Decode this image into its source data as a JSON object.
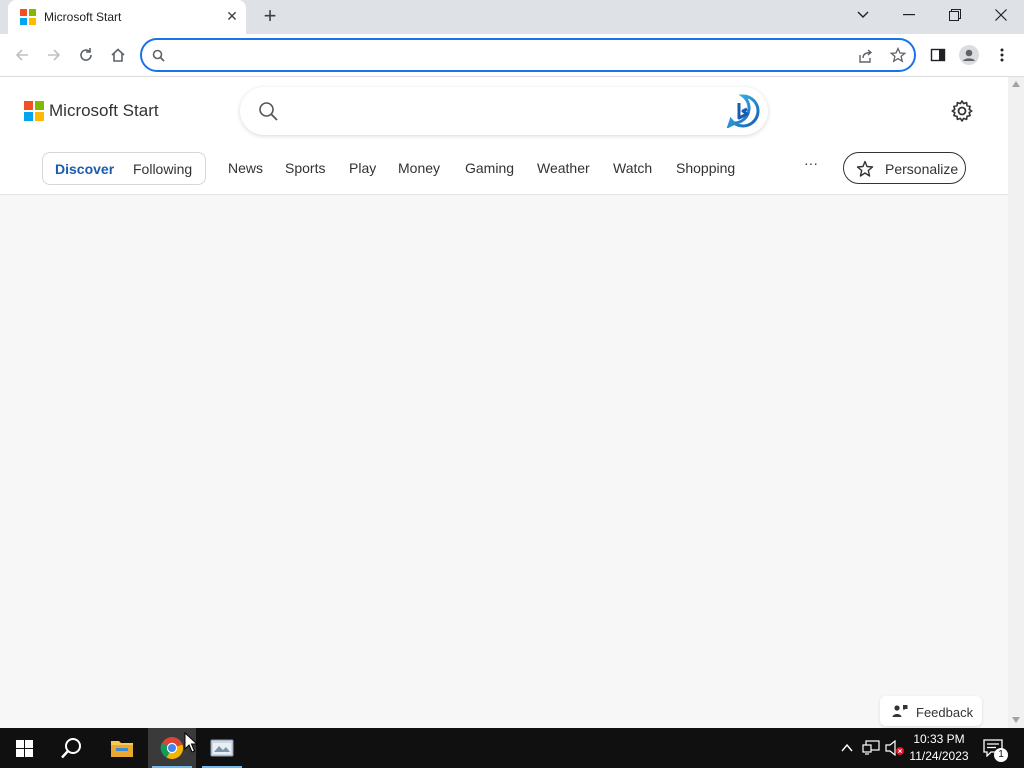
{
  "browser": {
    "tab_title": "Microsoft Start",
    "tab_close": "✕",
    "new_tab": "+",
    "address_value": "",
    "address_placeholder": ""
  },
  "window_controls": {
    "dropdown": "⌄",
    "minimize": "—",
    "restore": "❐",
    "close": "✕"
  },
  "site": {
    "logo_text": "Microsoft Start",
    "search_placeholder": "",
    "pill_tabs": [
      {
        "label": "Discover",
        "active": true
      },
      {
        "label": "Following",
        "active": false
      }
    ],
    "nav_items": [
      "News",
      "Sports",
      "Play",
      "Money",
      "Gaming",
      "Weather",
      "Watch",
      "Shopping"
    ],
    "more_label": "···",
    "personalize_label": "Personalize",
    "feedback_label": "Feedback"
  },
  "taskbar": {
    "time": "10:33 PM",
    "date": "11/24/2023",
    "notification_count": "1"
  },
  "colors": {
    "accent": "#1a73e8",
    "active_tab_text": "#1a5cb0",
    "ms_red": "#f25022",
    "ms_green": "#7fba00",
    "ms_blue": "#00a4ef",
    "ms_yellow": "#ffb900"
  }
}
